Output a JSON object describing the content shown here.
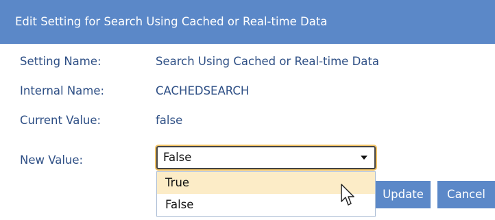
{
  "dialog": {
    "title": "Edit Setting for Search Using Cached or Real-time Data"
  },
  "fields": {
    "setting_name": {
      "label": "Setting Name:",
      "value": "Search Using Cached or Real-time Data"
    },
    "internal_name": {
      "label": "Internal Name:",
      "value": "CACHEDSEARCH"
    },
    "current_value": {
      "label": "Current Value:",
      "value": "false"
    },
    "new_value": {
      "label": "New Value:",
      "selected": "False"
    }
  },
  "dropdown": {
    "options": [
      "True",
      "False"
    ],
    "highlighted": "True"
  },
  "buttons": {
    "update": "Update",
    "cancel": "Cancel"
  },
  "colors": {
    "accent": "#5b88c8",
    "label_text": "#2e4f85",
    "focus_ring": "#f0c266",
    "option_highlight": "#fcecc7"
  },
  "icons": {
    "select_arrow": "chevron-down-icon",
    "cursor": "mouse-pointer-icon"
  }
}
